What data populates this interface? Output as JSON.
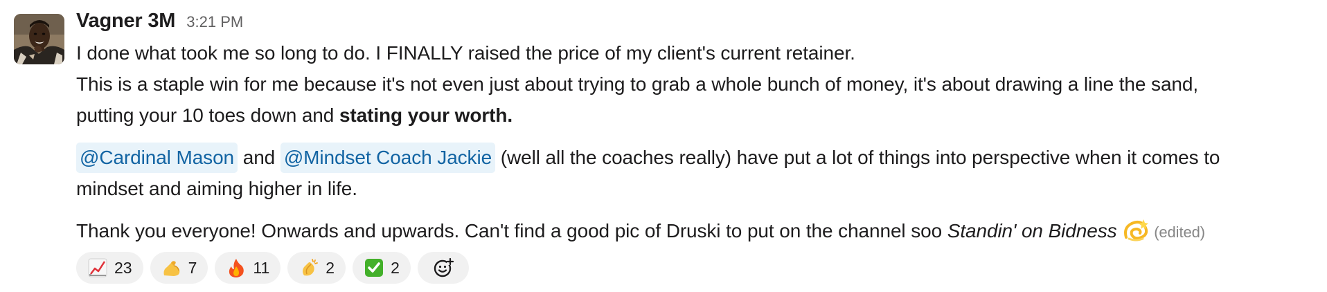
{
  "message": {
    "author": "Vagner 3M",
    "timestamp": "3:21 PM",
    "line1": "I done what took me so long to do. I FINALLY raised the price of my client's current retainer.",
    "line2": "This is a staple win for me because it's not even just about trying to grab a whole bunch of money, it's about drawing a line the sand,",
    "line3_plain": "putting your 10 toes down and ",
    "line3_bold": "stating your worth.",
    "mention1": "@Cardinal Mason",
    "and_text": "and",
    "mention2": "@Mindset Coach Jackie",
    "line4_rest": "(well all the coaches really) have put a lot of things into perspective when it comes to",
    "line5": "mindset and aiming higher in life.",
    "line6_plain": "Thank you everyone! Onwards and upwards. Can't find a good pic of Druski to put on the channel soo ",
    "line6_italic": "Standin' on Bidness",
    "line6_emoji": "dizzy-emoji",
    "edited": "(edited)"
  },
  "reactions": [
    {
      "emoji": "chart-increasing-icon",
      "count": "23"
    },
    {
      "emoji": "flexed-biceps-icon",
      "count": "7"
    },
    {
      "emoji": "fire-icon",
      "count": "11"
    },
    {
      "emoji": "clapping-hands-icon",
      "count": "2"
    },
    {
      "emoji": "check-mark-button-icon",
      "count": "2"
    }
  ],
  "add_reaction": {
    "icon": "add-emoji-icon"
  },
  "colors": {
    "mention_bg": "#e8f3fa",
    "mention_text": "#1264a3",
    "reaction_bg": "#f1f1f1",
    "timestamp": "#616061"
  }
}
